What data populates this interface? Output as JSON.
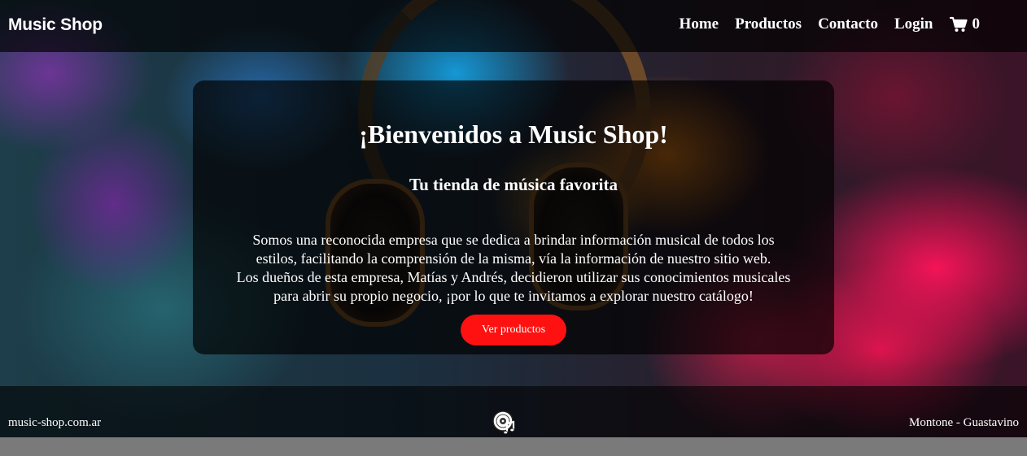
{
  "navbar": {
    "brand": "Music Shop",
    "links": [
      "Home",
      "Productos",
      "Contacto",
      "Login"
    ],
    "cart": {
      "icon": "shopping-cart-icon",
      "count": "0"
    }
  },
  "hero": {
    "title": "¡Bienvenidos a Music Shop!",
    "subtitle": "Tu tienda de música favorita",
    "lines": [
      "Somos una reconocida empresa que se dedica a brindar información musical de todos los",
      "estilos, facilitando la comprensión de la misma, vía la información de nuestro sitio web.",
      "Los dueños de esta empresa, Matías y Andrés, decidieron utilizar sus conocimientos musicales",
      "para abrir su propio negocio, ¡por lo que te invitamos a explorar nuestro catálogo!"
    ],
    "button_label": "Ver productos"
  },
  "footer": {
    "left_text": "music-shop.com.ar",
    "logo_icon": "music-disc-icon",
    "right_text": "Montone - Guastavino"
  },
  "colors": {
    "button": "#ff1111",
    "overlay": "rgba(0,0,0,0.68)",
    "text": "#ffffff"
  }
}
